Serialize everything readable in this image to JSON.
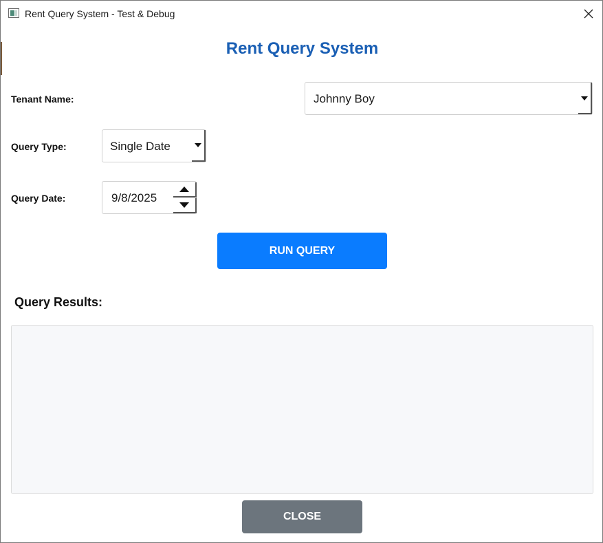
{
  "window": {
    "title": "Rent Query System - Test & Debug"
  },
  "heading": "Rent Query System",
  "form": {
    "tenant_label": "Tenant Name:",
    "tenant_value": "Johnny Boy",
    "query_type_label": "Query Type:",
    "query_type_value": "Single Date",
    "query_date_label": "Query Date:",
    "query_date_value": "9/8/2025"
  },
  "buttons": {
    "run_label": "RUN QUERY",
    "close_label": "CLOSE"
  },
  "results": {
    "label": "Query Results:"
  },
  "colors": {
    "heading": "#1a5fb4",
    "run_button": "#0a7cff",
    "close_button": "#6c757d",
    "results_background": "#f7f8fa"
  },
  "icons": {
    "app": "window-app-icon",
    "close": "close-icon",
    "dropdown": "caret-down-icon",
    "spin_up": "triangle-up-icon",
    "spin_down": "triangle-down-icon"
  }
}
